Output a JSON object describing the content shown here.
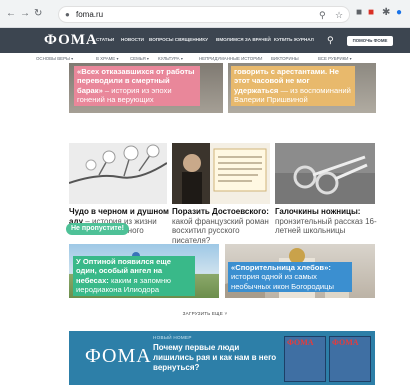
{
  "browser": {
    "url": "foma.ru"
  },
  "header": {
    "logo": "ФОМА",
    "nav": [
      "статьи",
      "новости",
      "вопросы священнику",
      "вмолимся за врачей",
      "купить журнал"
    ],
    "subscribe_label": "Помочь Фоме"
  },
  "categories": [
    "Основы веры",
    "В храме",
    "Семья",
    "Культура",
    "Непридуманные истории",
    "Викторины",
    "Все рубрики"
  ],
  "cards": {
    "top_left": {
      "headline": "«Всех отказавшихся от работы переводили в смертный барак»",
      "sub": " – история из эпохи гонений на верующих"
    },
    "top_right": {
      "headline": "говорить с арестантами. Не этот часовой не мог удержаться",
      "sub": " — из воспоминаний Валерии Пришвиной"
    },
    "mid_1": {
      "bold": "Чудо в черном и душном аду",
      "rest": " – история из жизни одного осужденного",
      "badge": "Не пропустите!"
    },
    "mid_2": {
      "bold": "Поразить Достоевского:",
      "rest": " какой французский роман восхитил русского писателя?"
    },
    "mid_3": {
      "bold": "Галочкины ножницы:",
      "rest": " пронзительный рассказ 16-летней школьницы"
    },
    "bottom_left": {
      "headline": "У Оптиной появился еще один, особый ангел на небесах:",
      "sub": " каким я запомню иеродиакона Илиодора"
    },
    "bottom_right": {
      "headline": "«Спорительница хлебов»:",
      "sub": " история одной из самых необычных икон Богородицы"
    }
  },
  "load_more": "Загрузить еще",
  "banner": {
    "logo": "ФОМА",
    "label": "Новый номер",
    "text": "Почему первые люди лишились рая и как нам в него вернуться?",
    "mag_title": "ФОМА"
  },
  "colors": {
    "header_bg": "#3c4550",
    "pink": "#e9879a",
    "yellow": "#e8b96c",
    "green": "#39b989",
    "blue": "#3b8fd0",
    "banner_bg": "#2d7fa8"
  }
}
